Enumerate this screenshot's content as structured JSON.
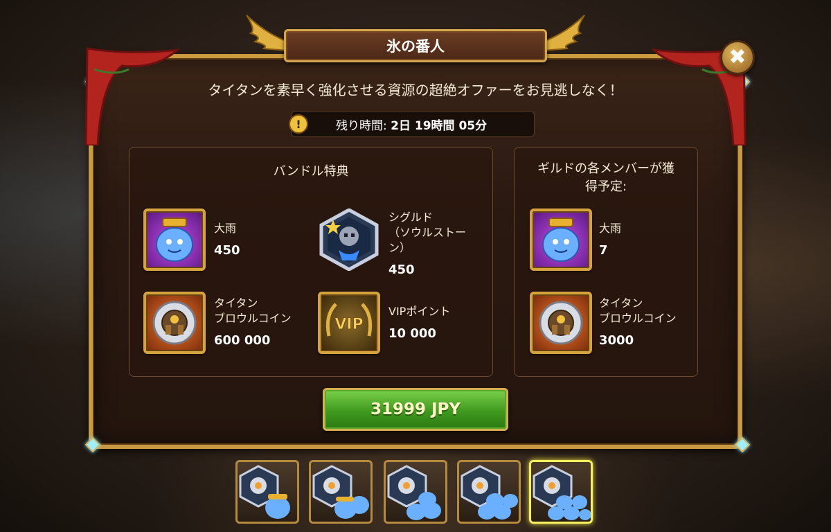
{
  "title": "氷の番人",
  "subtitle": "タイタンを素早く強化させる資源の超絶オファーをお見逃しなく！",
  "timer": {
    "label": "残り時間:",
    "value": "2日 19時間 05分"
  },
  "bundle": {
    "title": "バンドル特典",
    "items": [
      {
        "name": "大雨",
        "amount": "450",
        "icon": "potion-jar-icon"
      },
      {
        "name": "シグルド\n（ソウルストー\nン）",
        "amount": "450",
        "icon": "hero-soulstone-icon"
      },
      {
        "name": "タイタン\nブロウルコイン",
        "amount": "600 000",
        "icon": "titan-coin-icon"
      },
      {
        "name": "VIPポイント",
        "amount": "10 000",
        "icon": "vip-icon"
      }
    ]
  },
  "guild": {
    "title": "ギルドの各メンバーが獲\n得予定:",
    "items": [
      {
        "name": "大雨",
        "amount": "7",
        "icon": "potion-jar-icon"
      },
      {
        "name": "タイタン\nブロウルコイン",
        "amount": "3000",
        "icon": "titan-coin-icon"
      }
    ]
  },
  "buy_button": "31999 JPY",
  "tabs_selected_index": 4,
  "colors": {
    "frame_gold": "#c99a3f",
    "buy_green": "#3f9a1e",
    "accent_gem": "#9ef0ff"
  }
}
